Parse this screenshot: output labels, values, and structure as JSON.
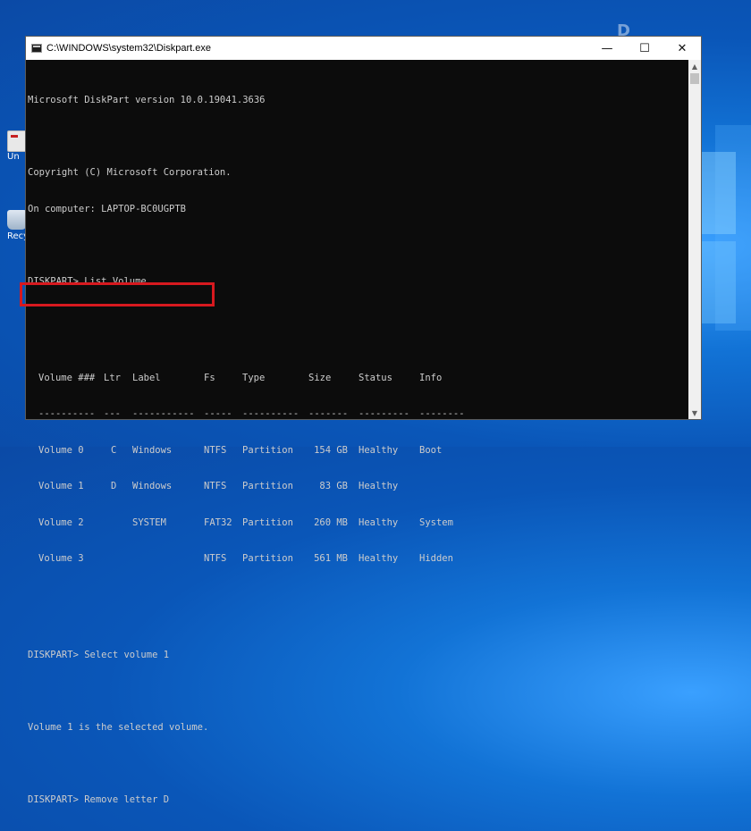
{
  "window": {
    "title": "C:\\WINDOWS\\system32\\Diskpart.exe",
    "minimize": "—",
    "maximize": "☐",
    "close": "✕"
  },
  "desktop": {
    "watermark": "D",
    "icons": [
      {
        "name": "uninstall",
        "label": "Un"
      },
      {
        "name": "recycle-bin",
        "label": "Recy"
      }
    ]
  },
  "console": {
    "version_line": "Microsoft DiskPart version 10.0.19041.3636",
    "copyright_line": "Copyright (C) Microsoft Corporation.",
    "computer_line": "On computer: LAPTOP-BC0UGPTB",
    "cmd_list": "DISKPART> List Volume",
    "table": {
      "headers": [
        "Volume ###",
        "Ltr",
        "Label",
        "Fs",
        "Type",
        "Size",
        "Status",
        "Info"
      ],
      "separators": [
        "----------",
        "---",
        "-----------",
        "-----",
        "----------",
        "-------",
        "---------",
        "--------"
      ],
      "rows": [
        [
          "Volume 0",
          "C",
          "Windows",
          "NTFS",
          "Partition",
          "154 GB",
          "Healthy",
          "Boot"
        ],
        [
          "Volume 1",
          "D",
          "Windows",
          "NTFS",
          "Partition",
          "83 GB",
          "Healthy",
          ""
        ],
        [
          "Volume 2",
          "",
          "SYSTEM",
          "FAT32",
          "Partition",
          "260 MB",
          "Healthy",
          "System"
        ],
        [
          "Volume 3",
          "",
          "",
          "NTFS",
          "Partition",
          "561 MB",
          "Healthy",
          "Hidden"
        ]
      ]
    },
    "cmd_select": "DISKPART> Select volume 1",
    "select_result": "Volume 1 is the selected volume.",
    "cmd_remove": "DISKPART> Remove letter D"
  },
  "colors": {
    "highlight": "#d7191f",
    "console_bg": "#0c0c0c",
    "console_text": "#cccccc"
  }
}
